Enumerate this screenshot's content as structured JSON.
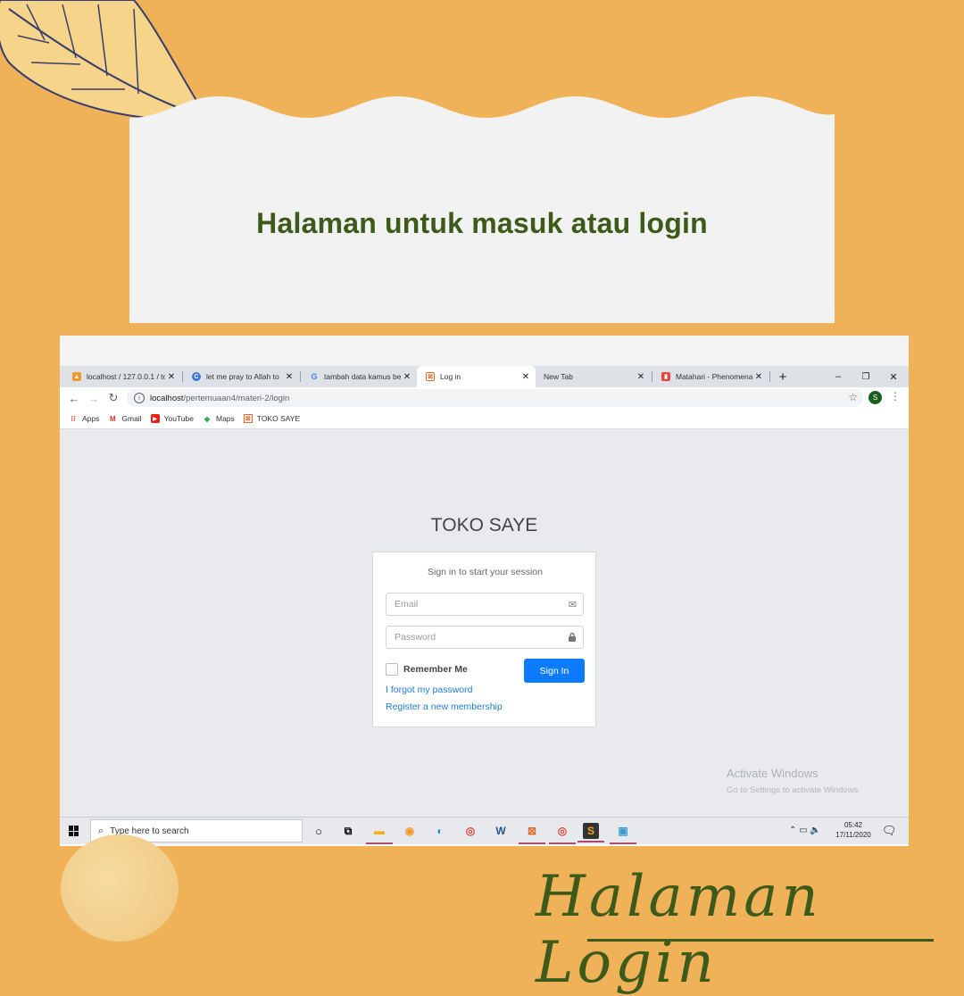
{
  "heading": "Halaman untuk masuk atau login",
  "caption": "Halaman Login",
  "browser": {
    "tabs": [
      {
        "title": "localhost / 127.0.0.1 / to",
        "icon": "phpmyadmin-icon",
        "active": false
      },
      {
        "title": "let me pray to Allah to",
        "icon": "c-site-icon",
        "active": false
      },
      {
        "title": "tambah data kamus be",
        "icon": "google-icon",
        "active": false
      },
      {
        "title": "Log in",
        "icon": "xampp-icon",
        "active": true
      },
      {
        "title": "New Tab",
        "icon": "",
        "active": false
      },
      {
        "title": "Matahari - Phenomena",
        "icon": "shopping-bag-icon",
        "active": false
      }
    ],
    "new_tab": "+",
    "window_controls": {
      "minimize": "–",
      "restore": "❐",
      "close": "✕"
    },
    "url_host": "localhost",
    "url_path": "/pertemuaan4/materi-2/login",
    "profile_initial": "S",
    "bookmarks": [
      {
        "label": "Apps",
        "icon": "apps-grid-icon"
      },
      {
        "label": "Gmail",
        "icon": "gmail-icon"
      },
      {
        "label": "YouTube",
        "icon": "youtube-icon"
      },
      {
        "label": "Maps",
        "icon": "maps-icon"
      },
      {
        "label": "TOKO SAYE",
        "icon": "xampp-icon"
      }
    ]
  },
  "login": {
    "brand": "TOKO SAYE",
    "subtitle": "Sign in to start your session",
    "email_placeholder": "Email",
    "password_placeholder": "Password",
    "remember_label": "Remember Me",
    "remember_checked": false,
    "signin_label": "Sign In",
    "forgot_link": "I forgot my password",
    "register_link": "Register a new membership"
  },
  "watermark": {
    "title": "Activate Windows",
    "subtitle": "Go to Settings to activate Windows."
  },
  "taskbar": {
    "search_placeholder": "Type here to search",
    "time": "05:42",
    "date": "17/11/2020"
  },
  "colors": {
    "background": "#efb258",
    "heading": "#3e5a1a",
    "signin_button": "#0d7bff",
    "link": "#1f7bd6"
  }
}
